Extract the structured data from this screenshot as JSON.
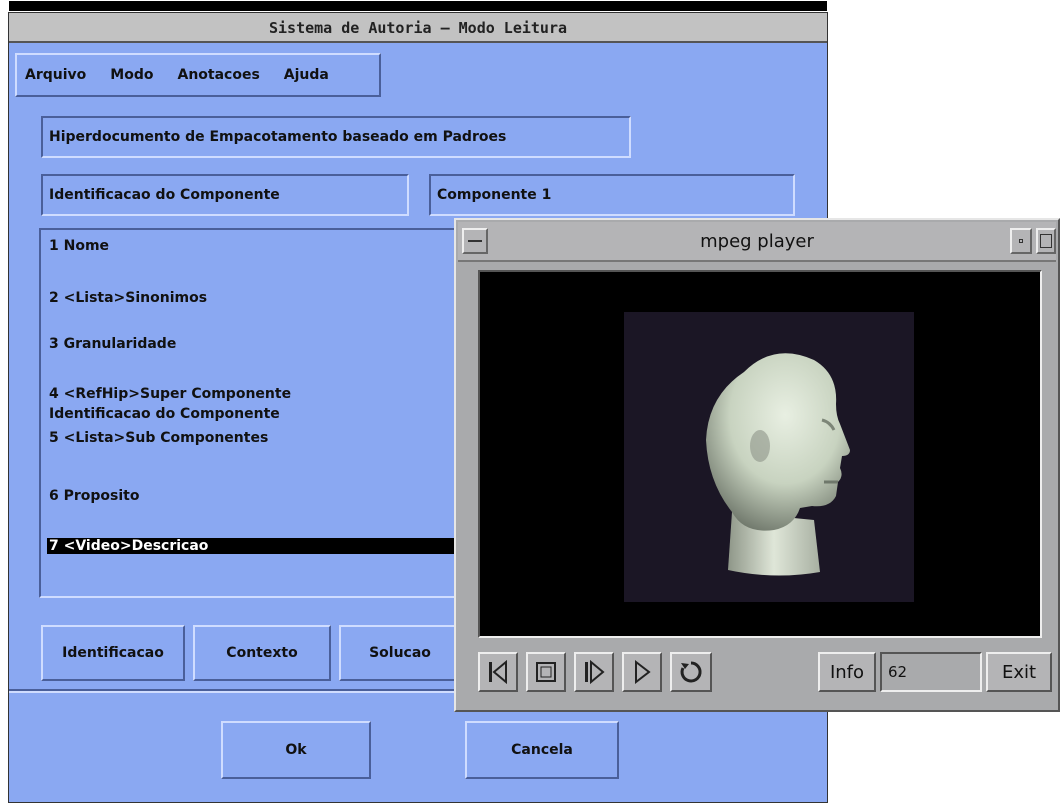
{
  "main_window": {
    "title": "Sistema de Autoria – Modo Leitura",
    "menu": [
      "Arquivo",
      "Modo",
      "Anotacoes",
      "Ajuda"
    ],
    "document_title": "Hiperdocumento de Empacotamento baseado em Padroes",
    "component_label": "Identificacao do Componente",
    "component_value": "Componente 1",
    "attribute_list": [
      "1 Nome",
      "2 <Lista>Sinonimos",
      "3 Granularidade",
      "4 <RefHip>Super Componente",
      "Identificacao do Componente",
      "5 <Lista>Sub Componentes",
      "6 Proposito",
      "7 <Video>Descricao"
    ],
    "selected_item": "7 <Video>Descricao",
    "tab_buttons": [
      "Identificacao",
      "Contexto",
      "Solucao"
    ],
    "ok_label": "Ok",
    "cancel_label": "Cancela",
    "background_color": "#8aa8f2"
  },
  "mpeg_player": {
    "title": "mpeg player",
    "info_label": "Info",
    "frame_number": "62",
    "exit_label": "Exit",
    "controls": [
      "rewind-icon",
      "stop-icon",
      "step-forward-icon",
      "play-icon",
      "loop-icon"
    ]
  }
}
